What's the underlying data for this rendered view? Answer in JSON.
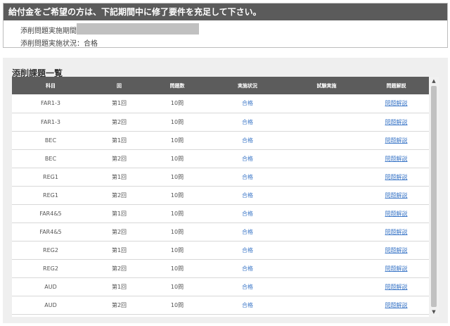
{
  "notice": {
    "heading": "給付金をご希望の方は、下記期間中に修了要件を充足して下さい。",
    "period_label": "添削問題実施期間：",
    "status_label": "添削問題実施状況：合格"
  },
  "panel": {
    "title": "添削課題一覧"
  },
  "table": {
    "headers": [
      "科目",
      "回",
      "問題数",
      "実施状況",
      "試験実施",
      "問題解説"
    ],
    "rows": [
      {
        "subject": "FAR1-3",
        "round": "第1回",
        "count": "10問",
        "status": "合格",
        "exam": "",
        "explain": "問題解説"
      },
      {
        "subject": "FAR1-3",
        "round": "第2回",
        "count": "10問",
        "status": "合格",
        "exam": "",
        "explain": "問題解説"
      },
      {
        "subject": "BEC",
        "round": "第1回",
        "count": "10問",
        "status": "合格",
        "exam": "",
        "explain": "問題解説"
      },
      {
        "subject": "BEC",
        "round": "第2回",
        "count": "10問",
        "status": "合格",
        "exam": "",
        "explain": "問題解説"
      },
      {
        "subject": "REG1",
        "round": "第1回",
        "count": "10問",
        "status": "合格",
        "exam": "",
        "explain": "問題解説"
      },
      {
        "subject": "REG1",
        "round": "第2回",
        "count": "10問",
        "status": "合格",
        "exam": "",
        "explain": "問題解説"
      },
      {
        "subject": "FAR4&5",
        "round": "第1回",
        "count": "10問",
        "status": "合格",
        "exam": "",
        "explain": "問題解説"
      },
      {
        "subject": "FAR4&5",
        "round": "第2回",
        "count": "10問",
        "status": "合格",
        "exam": "",
        "explain": "問題解説"
      },
      {
        "subject": "REG2",
        "round": "第1回",
        "count": "10問",
        "status": "合格",
        "exam": "",
        "explain": "問題解説"
      },
      {
        "subject": "REG2",
        "round": "第2回",
        "count": "10問",
        "status": "合格",
        "exam": "",
        "explain": "問題解説"
      },
      {
        "subject": "AUD",
        "round": "第1回",
        "count": "10問",
        "status": "合格",
        "exam": "",
        "explain": "問題解説"
      },
      {
        "subject": "AUD",
        "round": "第2回",
        "count": "10問",
        "status": "合格",
        "exam": "",
        "explain": "問題解説"
      }
    ]
  },
  "scrollbar": {
    "up_icon": "▲",
    "down_icon": "▼"
  },
  "colors": {
    "header_bg": "#5b5b5b",
    "link": "#3f79c8",
    "panel_bg": "#efefef"
  }
}
